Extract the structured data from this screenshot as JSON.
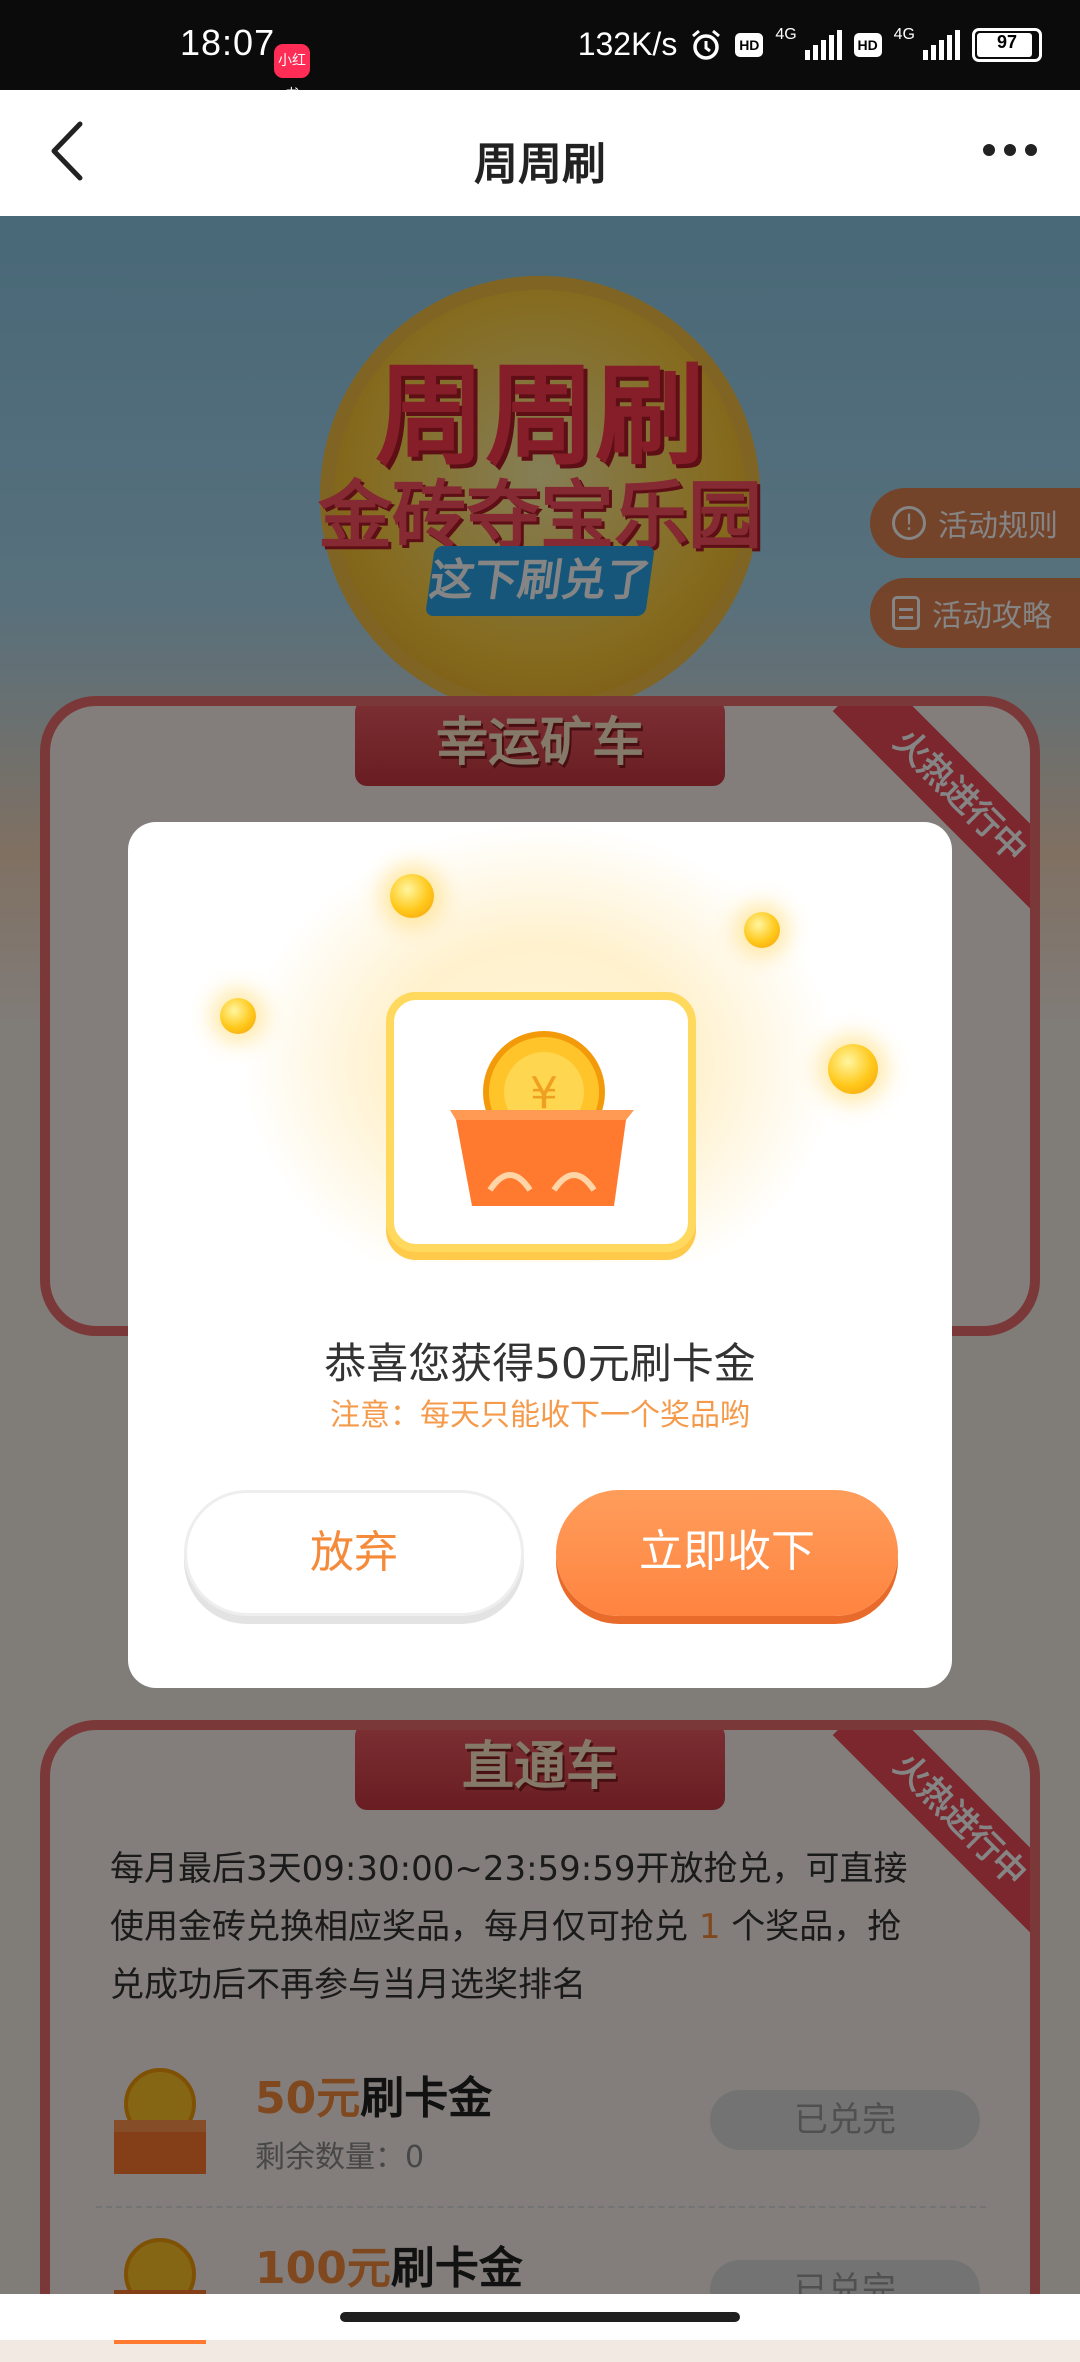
{
  "status_bar": {
    "time": "18:07",
    "app_badge": "小红书",
    "net_speed": "132K/s",
    "hd1": "HD",
    "hd2": "HD",
    "net1": "4G",
    "net2": "4G",
    "battery": "97"
  },
  "header": {
    "title": "周周刷",
    "back_icon": "chevron-left-icon",
    "more_icon": "more-dots-icon"
  },
  "banner": {
    "title_line1": "周周刷",
    "title_line2": "金砖夺宝乐园",
    "tag": "这下刷兑了"
  },
  "side_actions": {
    "rules": "活动规则",
    "guide": "活动攻略"
  },
  "card1": {
    "header": "幸运矿车",
    "ribbon": "火热进行中"
  },
  "card2": {
    "header": "直通车",
    "ribbon": "火热进行中",
    "desc_part1": "每月最后3天09:30:00~23:59:59开放抢兑，可直接使用金砖兑换相应奖品，每月仅可抢兑 ",
    "desc_highlight": "1",
    "desc_part2": " 个奖品，抢兑成功后不再参与当月选奖排名",
    "prizes": [
      {
        "amount": "50元",
        "name": "刷卡金",
        "qty_label": "剩余数量：",
        "qty": "0",
        "button": "已兑完"
      },
      {
        "amount": "100元",
        "name": "刷卡金",
        "qty_label": "",
        "qty": "",
        "button": "已兑完"
      }
    ]
  },
  "modal": {
    "title": "恭喜您获得50元刷卡金",
    "note": "注意：每天只能收下一个奖品哟",
    "abandon_label": "放弃",
    "accept_label": "立即收下"
  },
  "colors": {
    "accent_orange": "#ff8c48",
    "brand_red": "#ec6b6b",
    "note_orange": "#f59a4a"
  }
}
